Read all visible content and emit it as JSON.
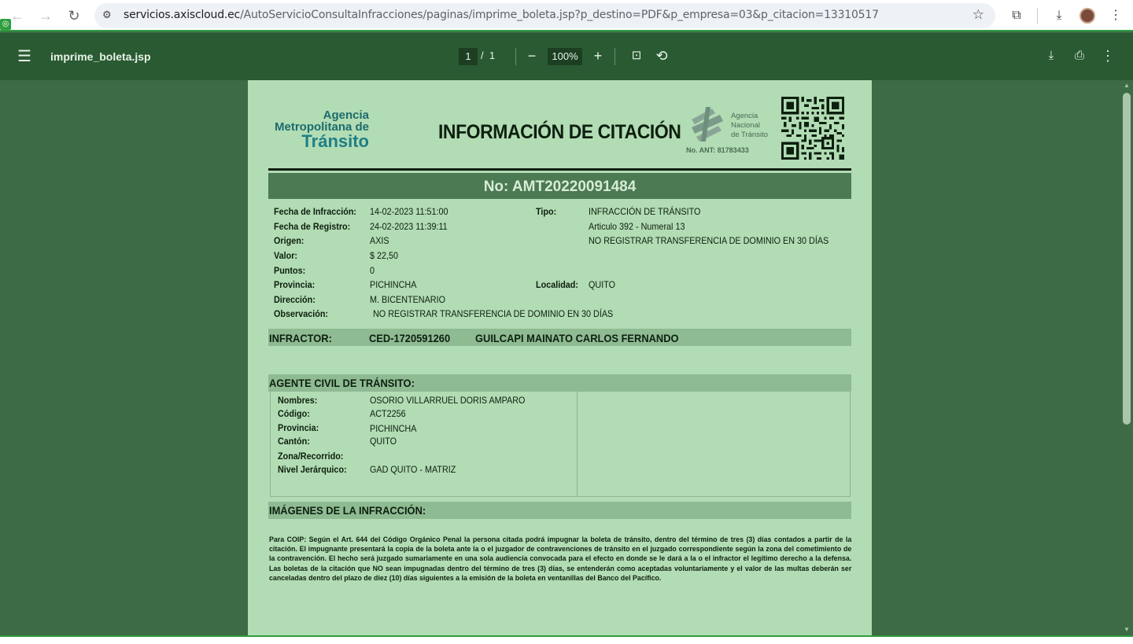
{
  "browser": {
    "url_host": "servicios.axiscloud.ec",
    "url_path": "/AutoServicioConsultaInfracciones/paginas/imprime_boleta.jsp?p_destino=PDF&p_empresa=03&p_citacion=13310517",
    "icons": [
      "back-arrow-icon",
      "forward-arrow-icon",
      "reload-icon",
      "site-info-icon",
      "bookmark-star-icon",
      "extensions-icon",
      "download-icon",
      "avatar",
      "more-vert-icon"
    ]
  },
  "pdf_toolbar": {
    "file_name": "imprime_boleta.jsp",
    "current_page": "1",
    "page_separator": "/",
    "total_pages": "1",
    "zoom": "100%",
    "zoom_out": "−",
    "zoom_in": "+"
  },
  "document": {
    "logo": {
      "line1": "Agencia",
      "line2": "Metropolitana de",
      "line3": "Tránsito"
    },
    "title": "INFORMACIÓN DE CITACIÓN",
    "ant": {
      "line1": "Agencia",
      "line2": "Nacional",
      "line3": "de Tránsito",
      "number": "No. ANT: 81783433"
    },
    "citation_number": "No: AMT20220091484",
    "fields": {
      "fecha_infraccion_label": "Fecha de Infracción:",
      "fecha_infraccion": "14-02-2023 11:51:00",
      "fecha_registro_label": "Fecha de Registro:",
      "fecha_registro": "24-02-2023 11:39:11",
      "origen_label": "Origen:",
      "origen": "AXIS",
      "valor_label": "Valor:",
      "valor": "$ 22,50",
      "puntos_label": "Puntos:",
      "puntos": "0",
      "provincia_label": "Provincia:",
      "provincia": "PICHINCHA",
      "direccion_label": "Dirección:",
      "direccion": "M. BICENTENARIO",
      "observacion_label": "Observación:",
      "observacion": "NO REGISTRAR TRANSFERENCIA DE DOMINIO EN 30 DÍAS",
      "tipo_label": "Tipo:",
      "tipo": "INFRACCIÓN DE TRÁNSITO",
      "articulo": "Articulo 392 - Numeral 13",
      "descripcion": "NO REGISTRAR TRANSFERENCIA DE DOMINIO EN 30 DÍAS",
      "localidad_label": "Localidad:",
      "localidad": "QUITO"
    },
    "infractor": {
      "label": "INFRACTOR:",
      "id": "CED-1720591260",
      "name": "GUILCAPI MAINATO CARLOS FERNANDO"
    },
    "agente": {
      "heading": "AGENTE CIVIL DE TRÁNSITO:",
      "nombres_label": "Nombres:",
      "nombres": "OSORIO VILLARRUEL DORIS AMPARO",
      "codigo_label": "Código:",
      "codigo": "ACT2256",
      "provincia_label": "Provincia:",
      "provincia": "PICHINCHA",
      "canton_label": "Cantón:",
      "canton": "QUITO",
      "zona_label": "Zona/Recorrido:",
      "nivel_label": "Nivel Jerárquico:",
      "nivel": "GAD QUITO - MATRIZ"
    },
    "imagenes_heading": "IMÁGENES DE LA INFRACCIÓN:",
    "legal_text": "Para COIP: Según el Art. 644 del Código Orgánico Penal la persona citada podrá impugnar la boleta de tránsito, dentro del término de tres (3) días contados a partir de la citación. El impugnante presentará la copia de la boleta ante la o el juzgador de contravenciones de tránsito en el juzgado correspondiente según la zona del cometimiento de la contravención. El hecho será juzgado sumariamente en una sola audiencia convocada para el efecto en donde se le dará a la o el infractor el legítimo derecho a la defensa. Las boletas de la citación que NO sean impugnadas dentro del término de tres (3) días, se entenderán como aceptadas voluntariamente y el valor de las multas deberán ser canceladas dentro del plazo de diez (10) días siguientes a la emisión de la boleta en ventanillas del Banco del Pacífico."
  },
  "colors": {
    "page_background": "#b2dcb4",
    "viewer_background": "#3d6b45",
    "toolbar": "#2a5a32",
    "header_bar": "#4c7a52",
    "section_bar": "#8fbb93"
  }
}
